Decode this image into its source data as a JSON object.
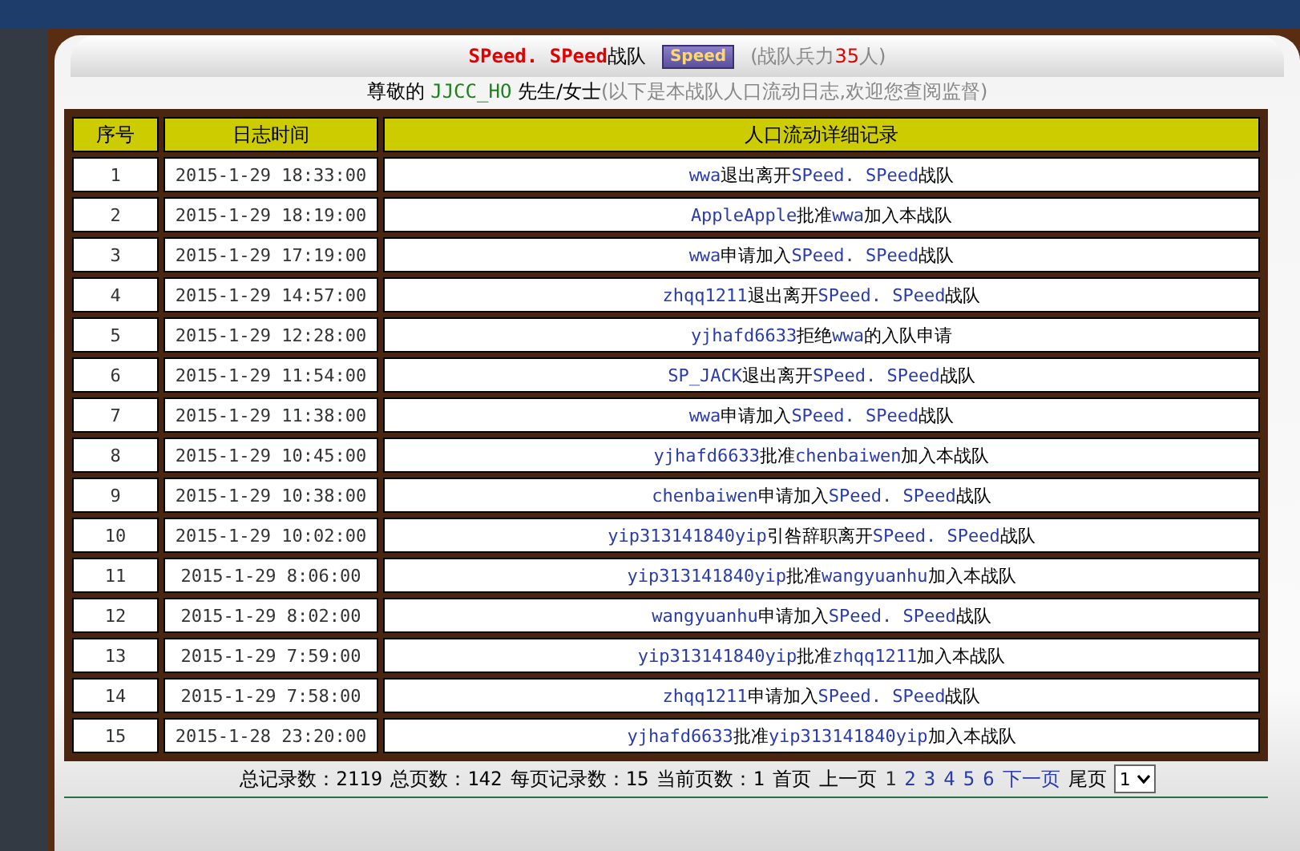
{
  "header": {
    "team_name": "SPeed. SPeed",
    "team_suffix": "战队",
    "badge": "Speed",
    "strength_prefix": "(战队兵力",
    "strength_count": "35",
    "strength_suffix": "人)"
  },
  "greeting": {
    "prefix": "尊敬的",
    "user": "JJCC_HO",
    "honorific": "先生/女士",
    "note": "(以下是本战队人口流动日志,欢迎您查阅监督)"
  },
  "table": {
    "columns": [
      "序号",
      "日志时间",
      "人口流动详细记录"
    ],
    "rows": [
      {
        "index": "1",
        "time": "2015-1-29 18:33:00",
        "detail": [
          {
            "kind": "link",
            "text": "wwa"
          },
          {
            "kind": "plain",
            "text": "退出离开"
          },
          {
            "kind": "link",
            "text": "SPeed. SPeed"
          },
          {
            "kind": "plain",
            "text": "战队"
          }
        ]
      },
      {
        "index": "2",
        "time": "2015-1-29 18:19:00",
        "detail": [
          {
            "kind": "link",
            "text": "AppleApple"
          },
          {
            "kind": "plain",
            "text": "批准"
          },
          {
            "kind": "link",
            "text": "wwa"
          },
          {
            "kind": "plain",
            "text": "加入本战队"
          }
        ]
      },
      {
        "index": "3",
        "time": "2015-1-29 17:19:00",
        "detail": [
          {
            "kind": "link",
            "text": "wwa"
          },
          {
            "kind": "plain",
            "text": "申请加入"
          },
          {
            "kind": "link",
            "text": "SPeed. SPeed"
          },
          {
            "kind": "plain",
            "text": "战队"
          }
        ]
      },
      {
        "index": "4",
        "time": "2015-1-29 14:57:00",
        "detail": [
          {
            "kind": "link",
            "text": "zhqq1211"
          },
          {
            "kind": "plain",
            "text": "退出离开"
          },
          {
            "kind": "link",
            "text": "SPeed. SPeed"
          },
          {
            "kind": "plain",
            "text": "战队"
          }
        ]
      },
      {
        "index": "5",
        "time": "2015-1-29 12:28:00",
        "detail": [
          {
            "kind": "link",
            "text": "yjhafd6633"
          },
          {
            "kind": "plain",
            "text": "拒绝"
          },
          {
            "kind": "link",
            "text": "wwa"
          },
          {
            "kind": "plain",
            "text": "的入队申请"
          }
        ]
      },
      {
        "index": "6",
        "time": "2015-1-29 11:54:00",
        "detail": [
          {
            "kind": "link",
            "text": "SP_JACK"
          },
          {
            "kind": "plain",
            "text": "退出离开"
          },
          {
            "kind": "link",
            "text": "SPeed. SPeed"
          },
          {
            "kind": "plain",
            "text": "战队"
          }
        ]
      },
      {
        "index": "7",
        "time": "2015-1-29 11:38:00",
        "detail": [
          {
            "kind": "link",
            "text": "wwa"
          },
          {
            "kind": "plain",
            "text": "申请加入"
          },
          {
            "kind": "link",
            "text": "SPeed. SPeed"
          },
          {
            "kind": "plain",
            "text": "战队"
          }
        ]
      },
      {
        "index": "8",
        "time": "2015-1-29 10:45:00",
        "detail": [
          {
            "kind": "link",
            "text": "yjhafd6633"
          },
          {
            "kind": "plain",
            "text": "批准"
          },
          {
            "kind": "link",
            "text": "chenbaiwen"
          },
          {
            "kind": "plain",
            "text": "加入本战队"
          }
        ]
      },
      {
        "index": "9",
        "time": "2015-1-29 10:38:00",
        "detail": [
          {
            "kind": "link",
            "text": "chenbaiwen"
          },
          {
            "kind": "plain",
            "text": "申请加入"
          },
          {
            "kind": "link",
            "text": "SPeed. SPeed"
          },
          {
            "kind": "plain",
            "text": "战队"
          }
        ]
      },
      {
        "index": "10",
        "time": "2015-1-29 10:02:00",
        "detail": [
          {
            "kind": "link",
            "text": "yip313141840yip"
          },
          {
            "kind": "plain",
            "text": "引咎辞职离开"
          },
          {
            "kind": "link",
            "text": "SPeed. SPeed"
          },
          {
            "kind": "plain",
            "text": "战队"
          }
        ]
      },
      {
        "index": "11",
        "time": "2015-1-29 8:06:00",
        "detail": [
          {
            "kind": "link",
            "text": "yip313141840yip"
          },
          {
            "kind": "plain",
            "text": "批准"
          },
          {
            "kind": "link",
            "text": "wangyuanhu"
          },
          {
            "kind": "plain",
            "text": "加入本战队"
          }
        ]
      },
      {
        "index": "12",
        "time": "2015-1-29 8:02:00",
        "detail": [
          {
            "kind": "link",
            "text": "wangyuanhu"
          },
          {
            "kind": "plain",
            "text": "申请加入"
          },
          {
            "kind": "link",
            "text": "SPeed. SPeed"
          },
          {
            "kind": "plain",
            "text": "战队"
          }
        ]
      },
      {
        "index": "13",
        "time": "2015-1-29 7:59:00",
        "detail": [
          {
            "kind": "link",
            "text": "yip313141840yip"
          },
          {
            "kind": "plain",
            "text": "批准"
          },
          {
            "kind": "link",
            "text": "zhqq1211"
          },
          {
            "kind": "plain",
            "text": "加入本战队"
          }
        ]
      },
      {
        "index": "14",
        "time": "2015-1-29 7:58:00",
        "detail": [
          {
            "kind": "link",
            "text": "zhqq1211"
          },
          {
            "kind": "plain",
            "text": "申请加入"
          },
          {
            "kind": "link",
            "text": "SPeed. SPeed"
          },
          {
            "kind": "plain",
            "text": "战队"
          }
        ]
      },
      {
        "index": "15",
        "time": "2015-1-28 23:20:00",
        "detail": [
          {
            "kind": "link",
            "text": "yjhafd6633"
          },
          {
            "kind": "plain",
            "text": "批准"
          },
          {
            "kind": "link",
            "text": "yip313141840yip"
          },
          {
            "kind": "plain",
            "text": "加入本战队"
          }
        ]
      }
    ]
  },
  "pagination": {
    "stats": [
      {
        "label": "总记录数：",
        "value": "2119"
      },
      {
        "label": "总页数：",
        "value": "142"
      },
      {
        "label": "每页记录数：",
        "value": "15"
      },
      {
        "label": "当前页数：",
        "value": "1"
      }
    ],
    "first": "首页",
    "prev": "上一页",
    "pages": [
      {
        "label": "1",
        "selected": true
      },
      {
        "label": "2",
        "selected": false
      },
      {
        "label": "3",
        "selected": false
      },
      {
        "label": "4",
        "selected": false
      },
      {
        "label": "5",
        "selected": false
      },
      {
        "label": "6",
        "selected": false
      }
    ],
    "next": "下一页",
    "last": "尾页",
    "page_select": "1"
  }
}
